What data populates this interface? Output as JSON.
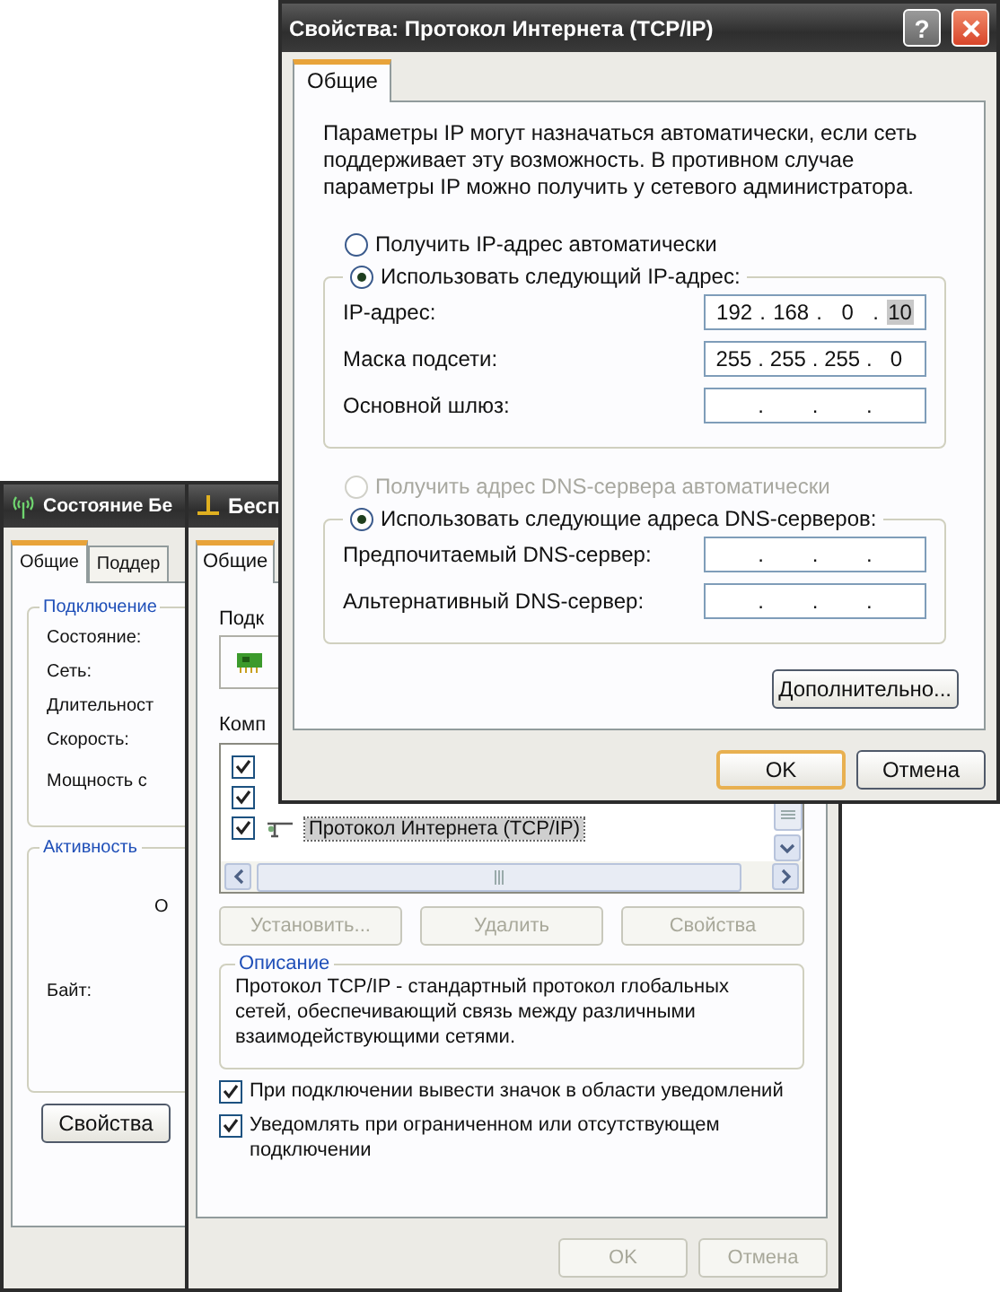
{
  "status_window": {
    "title": "Состояние Бе",
    "tabs": [
      {
        "label": "Общие",
        "selected": true
      },
      {
        "label": "Поддер",
        "selected": false
      }
    ],
    "connection_group": {
      "title": "Подключение",
      "labels": [
        "Состояние:",
        "Сеть:",
        "Длительност",
        "Скорость:",
        "Мощность с"
      ]
    },
    "activity_group": {
      "title": "Активность",
      "sent_label": "О",
      "bytes_label": "Байт:"
    },
    "button": "Свойства"
  },
  "connection_window": {
    "title": "Бесп",
    "tabs": [
      {
        "label": "Общие",
        "selected": true
      }
    ],
    "connect_label": "Подк",
    "components_label": "Комп",
    "components": [
      {
        "checked": true
      },
      {
        "checked": true
      },
      {
        "label": "Протокол Интернета (TCP/IP)",
        "checked": true,
        "selected": true
      }
    ],
    "component_buttons": [
      {
        "label": "Установить...",
        "disabled": true
      },
      {
        "label": "Удалить",
        "disabled": true
      },
      {
        "label": "Свойства",
        "disabled": true
      }
    ],
    "description": {
      "title": "Описание",
      "text": "Протокол TCP/IP - стандартный протокол глобальных сетей, обеспечивающий связь между различными взаимодействующими сетями."
    },
    "options": [
      {
        "label": "При подключении вывести значок в области уведомлений",
        "checked": true
      },
      {
        "label": "Уведомлять при ограниченном или отсутствующем подключении",
        "checked": true
      }
    ],
    "buttons": [
      {
        "label": "OK",
        "disabled": true
      },
      {
        "label": "Отмена",
        "disabled": true
      }
    ]
  },
  "tcpip_window": {
    "title": "Свойства: Протокол Интернета (TCP/IP)",
    "help": "?",
    "tabs": [
      {
        "label": "Общие",
        "selected": true
      }
    ],
    "intro": "Параметры IP могут назначаться автоматически, если сеть поддерживает эту возможность. В противном случае параметры IP можно получить у сетевого администратора.",
    "ip_separator": ".",
    "ip_modes": [
      {
        "label": "Получить IP-адрес автоматически",
        "selected": false,
        "disabled": false
      },
      {
        "label": "Использовать следующий IP-адрес:",
        "selected": true,
        "disabled": false
      }
    ],
    "ip_fields": [
      {
        "label": "IP-адрес:",
        "octets": [
          {
            "text": "192",
            "selected": false
          },
          {
            "text": "168",
            "selected": false
          },
          {
            "text": "0",
            "selected": false
          },
          {
            "text": "10",
            "selected": true
          }
        ]
      },
      {
        "label": "Маска подсети:",
        "octets": [
          {
            "text": "255",
            "selected": false
          },
          {
            "text": "255",
            "selected": false
          },
          {
            "text": "255",
            "selected": false
          },
          {
            "text": "0",
            "selected": false
          }
        ]
      },
      {
        "label": "Основной шлюз:"
      }
    ],
    "dns_modes": [
      {
        "label": "Получить адрес DNS-сервера автоматически",
        "selected": false,
        "disabled": true
      },
      {
        "label": "Использовать следующие адреса DNS-серверов:",
        "selected": true,
        "disabled": false
      }
    ],
    "dns_fields": [
      {
        "label": "Предпочитаемый DNS-сервер:"
      },
      {
        "label": "Альтернативный DNS-сервер:"
      }
    ],
    "advanced_button": "Дополнительно...",
    "buttons": [
      {
        "label": "OK",
        "default": true
      },
      {
        "label": "Отмена",
        "default": false
      }
    ]
  }
}
